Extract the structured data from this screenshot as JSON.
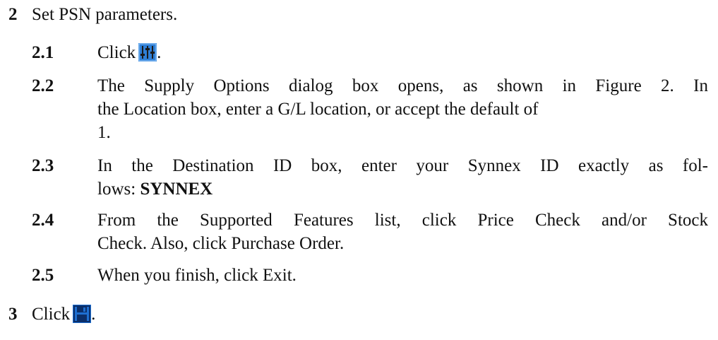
{
  "steps": [
    {
      "num": "2",
      "text": "Set PSN parameters."
    },
    {
      "num": "3",
      "text": "Click",
      "after": "."
    }
  ],
  "substeps": [
    {
      "num": "2.1",
      "text": "Click",
      "after": "."
    },
    {
      "num": "2.2",
      "lines": [
        "The Supply Options dialog box opens, as shown in Figure 2. In",
        "the Location box, enter a G/L location, or accept the default of",
        "1."
      ]
    },
    {
      "num": "2.3",
      "lines": [
        "In the Destination ID box, enter your Synnex ID exactly as fol-",
        "lows:"
      ],
      "bold": "SYNNEX"
    },
    {
      "num": "2.4",
      "lines": [
        "From the Supported Features list, click Price Check and/or Stock",
        "Check. Also, click Purchase Order."
      ]
    },
    {
      "num": "2.5",
      "text": "When you finish, click Exit."
    }
  ],
  "icons": {
    "options": "supply-options-icon",
    "save": "save-icon"
  },
  "colors": {
    "icon_blue": "#2f7fd6",
    "icon_bar": "#1a1a1a",
    "icon_light": "#9fd0ff",
    "save_blue": "#1e6fd1",
    "save_dark": "#0b2f6a"
  }
}
